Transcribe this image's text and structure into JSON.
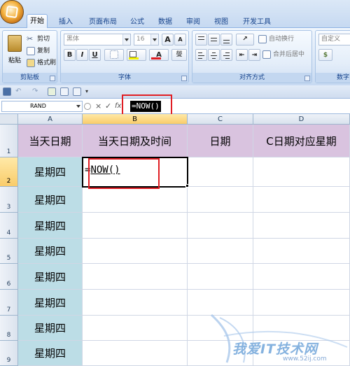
{
  "ribbon": {
    "tabs": [
      "开始",
      "插入",
      "页面布局",
      "公式",
      "数据",
      "审阅",
      "视图",
      "开发工具"
    ],
    "active_tab": "开始",
    "clipboard": {
      "paste": "粘贴",
      "cut": "剪切",
      "copy": "复制",
      "format_painter": "格式刷",
      "label": "剪贴板"
    },
    "font": {
      "name": "黑体",
      "size": "16",
      "grow": "A",
      "shrink": "A",
      "bold": "B",
      "italic": "I",
      "underline": "U",
      "color_a": "A",
      "phonetic": "燮",
      "label": "字体"
    },
    "alignment": {
      "wrap_text": "自动换行",
      "merge_center": "合并后居中",
      "label": "对齐方式"
    },
    "number": {
      "format": "自定义",
      "label": "数字"
    }
  },
  "formula_bar": {
    "name_box": "RAND",
    "fx": "fx",
    "cancel": "×",
    "enter": "✓",
    "formula": "=NOW()"
  },
  "sheet": {
    "columns": [
      "A",
      "B",
      "C",
      "D"
    ],
    "selected_column": "B",
    "rows": [
      "1",
      "2",
      "3",
      "4",
      "5",
      "6",
      "7",
      "8",
      "9"
    ],
    "selected_row": "2",
    "header_row": [
      "当天日期",
      "当天日期及时间",
      "日期",
      "C日期对应星期"
    ],
    "col_a_values": [
      "星期四",
      "星期四",
      "星期四",
      "星期四",
      "星期四",
      "星期四",
      "星期四",
      "星期四"
    ],
    "editing_cell": {
      "ref": "B2",
      "prefix": "=",
      "text": "NOW()"
    }
  },
  "watermark": {
    "text": "我爱IT技术网",
    "url": "www.52ij.com"
  },
  "colors": {
    "header_fill": "#d9c3df",
    "column_a_fill": "#bcdde6",
    "highlight_box": "#e01e24"
  }
}
